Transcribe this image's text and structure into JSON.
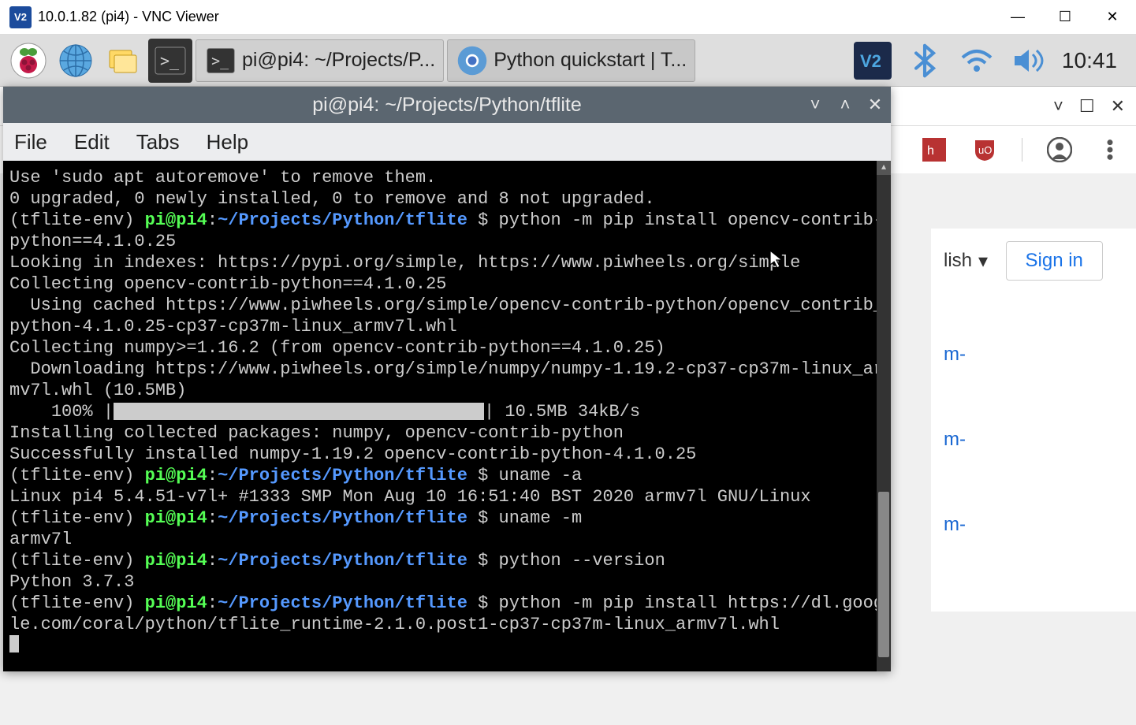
{
  "window": {
    "title": "10.0.1.82 (pi4) - VNC Viewer"
  },
  "rpi_taskbar": {
    "apps": [
      {
        "name": "start-menu",
        "label": ""
      },
      {
        "name": "web-browser",
        "label": ""
      },
      {
        "name": "file-manager",
        "label": ""
      },
      {
        "name": "terminal",
        "label": ""
      }
    ],
    "tasks": [
      {
        "name": "terminal-task",
        "label": "pi@pi4: ~/Projects/P..."
      },
      {
        "name": "chromium-task",
        "label": "Python quickstart  |  T..."
      }
    ],
    "clock": "10:41"
  },
  "browser_subbar": {
    "expand": "˅",
    "maximize": "☐",
    "close": "✕"
  },
  "browser_ext": {
    "ublock": "uO"
  },
  "browser_content": {
    "lang": "lish",
    "signin": "Sign in",
    "links": [
      "m-",
      "m-",
      "m-"
    ]
  },
  "terminal": {
    "title": "pi@pi4: ~/Projects/Python/tflite",
    "menu": [
      "File",
      "Edit",
      "Tabs",
      "Help"
    ],
    "prompt": {
      "env": "(tflite-env)",
      "userhost": "pi@pi4",
      "colon": ":",
      "path": "~/Projects/Python/tflite",
      "dollar": "$"
    },
    "lines": [
      "Use 'sudo apt autoremove' to remove them.",
      "0 upgraded, 0 newly installed, 0 to remove and 8 not upgraded."
    ],
    "cmd1": "python -m pip install opencv-contrib-python==4.1.0.25",
    "out1": [
      "Looking in indexes: https://pypi.org/simple, https://www.piwheels.org/simple",
      "Collecting opencv-contrib-python==4.1.0.25",
      "  Using cached https://www.piwheels.org/simple/opencv-contrib-python/opencv_contrib_python-4.1.0.25-cp37-cp37m-linux_armv7l.whl",
      "Collecting numpy>=1.16.2 (from opencv-contrib-python==4.1.0.25)",
      "  Downloading https://www.piwheels.org/simple/numpy/numpy-1.19.2-cp37-cp37m-linux_armv7l.whl (10.5MB)"
    ],
    "progress": {
      "pct": "100%",
      "after": " 10.5MB 34kB/s"
    },
    "out2": [
      "Installing collected packages: numpy, opencv-contrib-python",
      "Successfully installed numpy-1.19.2 opencv-contrib-python-4.1.0.25"
    ],
    "cmd2": "uname -a",
    "out3": "Linux pi4 5.4.51-v7l+ #1333 SMP Mon Aug 10 16:51:40 BST 2020 armv7l GNU/Linux",
    "cmd3": "uname -m",
    "out4": "armv7l",
    "cmd4": "python --version",
    "out5": "Python 3.7.3",
    "cmd5": "python -m pip install https://dl.google.com/coral/python/tflite_runtime-2.1.0.post1-cp37-cp37m-linux_armv7l.whl"
  }
}
